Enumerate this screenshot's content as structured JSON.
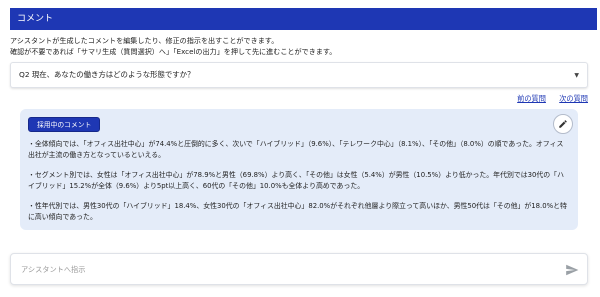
{
  "header": {
    "title": "コメント"
  },
  "intro": {
    "line1": "アシスタントが生成したコメントを編集したり、修正の指示を出すことができます。",
    "line2": "確認が不要であれば「サマリ生成（質問選択）へ」「Excelの出力」を押して先に進むことができます。"
  },
  "question_select": {
    "value": "Q2 現在、あなたの働き方はどのような形態ですか？",
    "chevron_icon": "chevron-down-icon"
  },
  "nav": {
    "prev": "前の質問",
    "next": "次の質問"
  },
  "comment": {
    "badge": "採用中のコメント",
    "edit_icon": "pencil-icon",
    "paragraphs": [
      "・全体傾向では、「オフィス出社中心」が74.4%と圧倒的に多く、次いで「ハイブリッド」（9.6%）、「テレワーク中心」（8.1%）、「その他」（8.0%）の順であった。オフィス出社が主流の働き方となっているといえる。",
      "・セグメント別では、女性は「オフィス出社中心」が78.9%と男性（69.8%）より高く、「その他」は女性（5.4%）が男性（10.5%）より低かった。年代別では30代の「ハイブリッド」15.2%が全体（9.6%）より5pt以上高く、60代の「その他」10.0%も全体より高めであった。",
      "・性年代別では、男性30代の「ハイブリッド」18.4%、女性30代の「オフィス出社中心」82.0%がそれぞれ他層より際立って高いほか、男性50代は「その他」が18.0%と特に高い傾向であった。"
    ]
  },
  "assistant_input": {
    "placeholder": "アシスタントへ指示",
    "value": ""
  },
  "send_icon": "send-icon",
  "colors": {
    "brand": "#1e37b4",
    "card_bg": "#e4ecf9"
  }
}
